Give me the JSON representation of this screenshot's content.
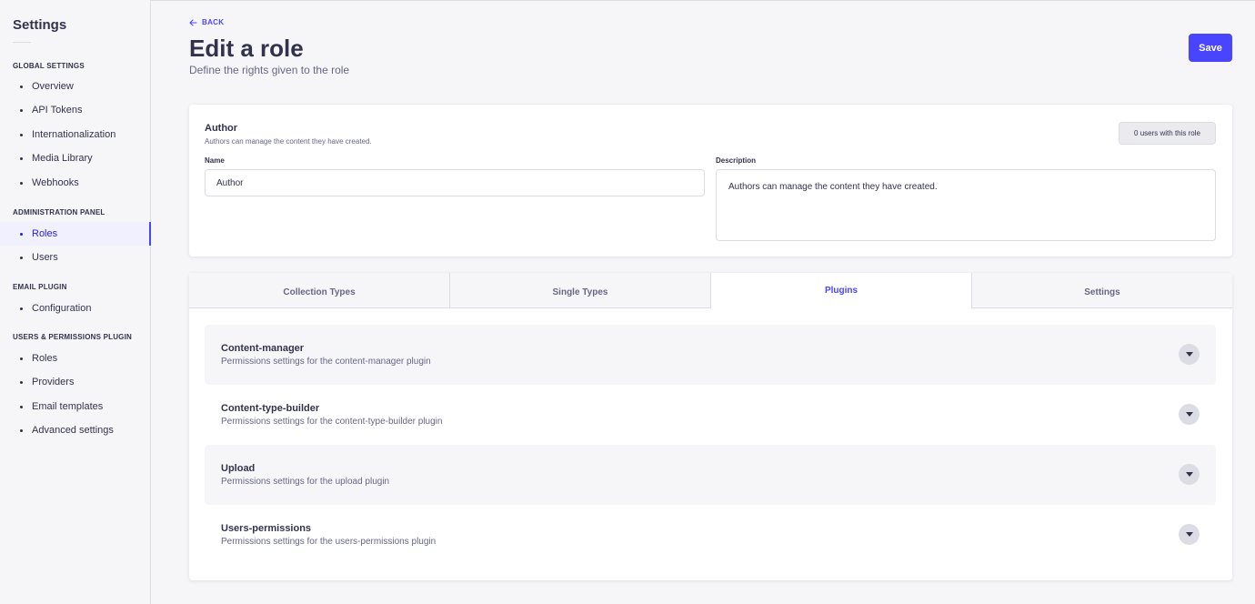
{
  "sidebar": {
    "title": "Settings",
    "sections": [
      {
        "label": "Global Settings",
        "items": [
          "Overview",
          "API Tokens",
          "Internationalization",
          "Media Library",
          "Webhooks"
        ]
      },
      {
        "label": "Administration Panel",
        "items": [
          "Roles",
          "Users"
        ]
      },
      {
        "label": "Email Plugin",
        "items": [
          "Configuration"
        ]
      },
      {
        "label": "Users & Permissions Plugin",
        "items": [
          "Roles",
          "Providers",
          "Email templates",
          "Advanced settings"
        ]
      }
    ],
    "active_item": "Roles"
  },
  "header": {
    "back_label": "BACK",
    "title": "Edit a role",
    "subtitle": "Define the rights given to the role",
    "save_label": "Save"
  },
  "role": {
    "name": "Author",
    "description": "Authors can manage the content they have created.",
    "users_badge": "0 users with this role",
    "name_label": "Name",
    "description_label": "Description",
    "name_value": "Author",
    "description_value": "Authors can manage the content they have created."
  },
  "tabs": [
    "Collection Types",
    "Single Types",
    "Plugins",
    "Settings"
  ],
  "active_tab": "Plugins",
  "plugins": [
    {
      "name": "Content-manager",
      "description": "Permissions settings for the content-manager plugin"
    },
    {
      "name": "Content-type-builder",
      "description": "Permissions settings for the content-type-builder plugin"
    },
    {
      "name": "Upload",
      "description": "Permissions settings for the upload plugin"
    },
    {
      "name": "Users-permissions",
      "description": "Permissions settings for the users-permissions plugin"
    }
  ],
  "colors": {
    "primary": "#4945ff",
    "text": "#32324d",
    "muted": "#666687"
  }
}
